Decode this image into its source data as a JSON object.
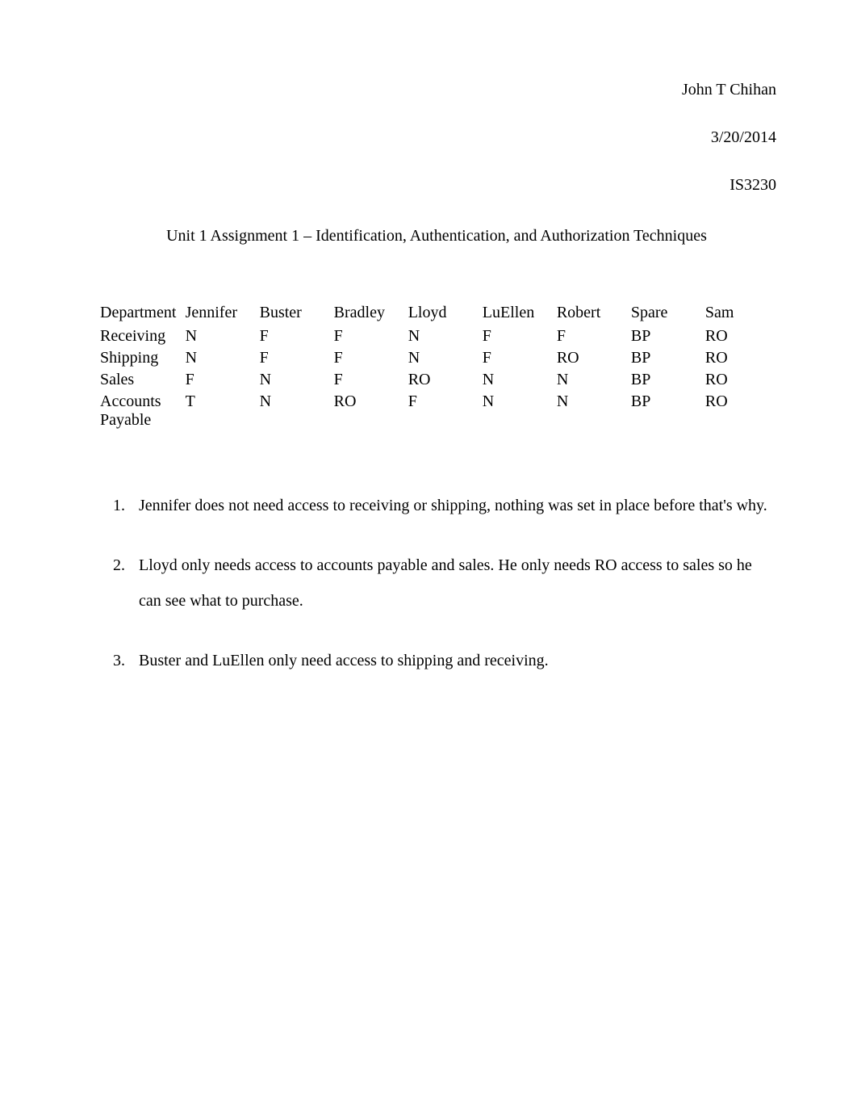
{
  "header": {
    "author": "John T Chihan",
    "date": "3/20/2014",
    "course": "IS3230"
  },
  "subtitle": "Unit 1 Assignment 1 – Identification, Authentication, and Authorization Techniques",
  "table": {
    "columns": [
      "Department",
      "Jennifer",
      "Buster",
      "Bradley",
      "Lloyd",
      "LuEllen",
      "Robert",
      "Spare",
      "Sam"
    ],
    "rows": [
      {
        "label": "Receiving",
        "cells": [
          "N",
          "F",
          "F",
          "N",
          "F",
          "F",
          "BP",
          "RO"
        ]
      },
      {
        "label": "Shipping",
        "cells": [
          "N",
          "F",
          "F",
          "N",
          "F",
          "RO",
          "BP",
          "RO"
        ]
      },
      {
        "label": "Sales",
        "cells": [
          "F",
          "N",
          "F",
          "RO",
          "N",
          "N",
          "BP",
          "RO"
        ]
      },
      {
        "label": "Accounts Payable",
        "cells": [
          "T",
          "N",
          "RO",
          "F",
          "N",
          "N",
          "BP",
          "RO"
        ]
      }
    ]
  },
  "notes": [
    "Jennifer does not need access to receiving or shipping, nothing was set in place before that's why.",
    "Lloyd only needs access to accounts payable and sales. He only needs RO access to sales so he can see what to purchase.",
    "Buster and LuEllen only need access to shipping and receiving."
  ]
}
